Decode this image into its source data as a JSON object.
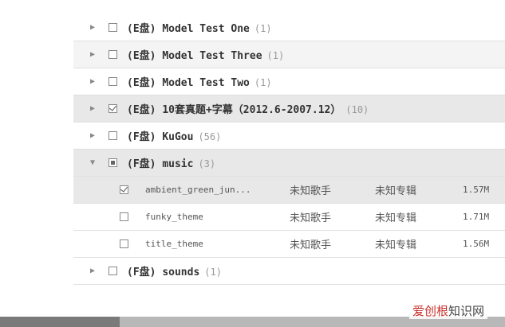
{
  "tree": {
    "folders": [
      {
        "drive": "(E盘)",
        "name": "Model Test One",
        "count": "(1)",
        "expanded": false,
        "check": "none",
        "style": "plain"
      },
      {
        "drive": "(E盘)",
        "name": "Model Test Three",
        "count": "(1)",
        "expanded": false,
        "check": "none",
        "style": "alt"
      },
      {
        "drive": "(E盘)",
        "name": "Model Test Two",
        "count": "(1)",
        "expanded": false,
        "check": "none",
        "style": "plain"
      },
      {
        "drive": "(E盘)",
        "name": "10套真题+字幕（2012.6-2007.12）",
        "count": "(10)",
        "expanded": false,
        "check": "checked",
        "style": "sel"
      },
      {
        "drive": "(F盘)",
        "name": "KuGou",
        "count": "(56)",
        "expanded": false,
        "check": "none",
        "style": "plain"
      },
      {
        "drive": "(F盘)",
        "name": "music",
        "count": "(3)",
        "expanded": true,
        "check": "partial",
        "style": "sel"
      }
    ],
    "files": [
      {
        "name": "ambient_green_jun...",
        "artist": "未知歌手",
        "album": "未知专辑",
        "size": "1.57M",
        "checked": true,
        "style": "sel"
      },
      {
        "name": "funky_theme",
        "artist": "未知歌手",
        "album": "未知专辑",
        "size": "1.71M",
        "checked": false,
        "style": "plain"
      },
      {
        "name": "title_theme",
        "artist": "未知歌手",
        "album": "未知专辑",
        "size": "1.56M",
        "checked": false,
        "style": "plain"
      }
    ],
    "last_folder": {
      "drive": "(F盘)",
      "name": "sounds",
      "count": "(1)",
      "expanded": false,
      "check": "none",
      "style": "plain"
    }
  },
  "icons": {
    "collapsed": "▶",
    "expanded": "▼"
  },
  "watermark": {
    "brand": "爱创根",
    "suffix": "知识网"
  },
  "colors": {
    "watermark_red": "#c9302c",
    "selected_row": "#e8e8e8"
  }
}
